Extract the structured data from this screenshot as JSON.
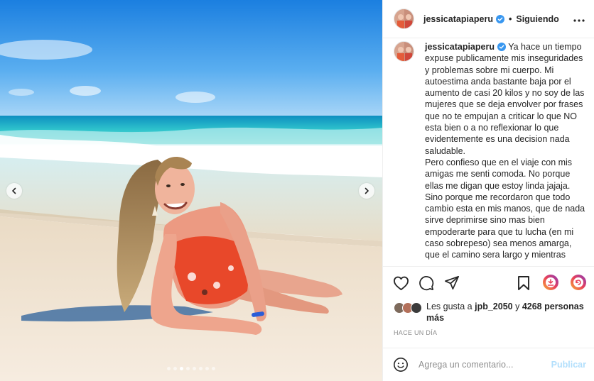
{
  "media": {
    "photo_alt": "",
    "carousel": {
      "total": 8,
      "active": 3
    },
    "icons": {
      "prev": "chevron-left-icon",
      "next": "chevron-right-icon"
    }
  },
  "header": {
    "username": "jessicatapiaperu",
    "separator": "•",
    "follow_status": "Siguiendo",
    "icons": {
      "verified": "verified-badge-icon",
      "more": "more-options-icon"
    }
  },
  "caption": {
    "username": "jessicatapiaperu",
    "text": "Ya hace un tiempo expuse publicamente mis inseguridades y problemas sobre mi cuerpo. Mi autoestima anda bastante baja por el aumento de casi 20 kilos y no soy de las mujeres que se deja envolver por frases que no te empujan a criticar lo que NO esta bien o a no reflexionar lo que evidentemente es una decision nada saludable.\nPero confieso que en el viaje con mis amigas me senti comoda. No porque ellas me digan que estoy linda jajaja. Sino porque me recordaron que todo cambio esta en mis manos, que de nada sirve deprimirse sino mas bien empoderarte para que tu lucha (en mi caso sobrepeso) sea menos amarga, que el camino sera largo y mientras"
  },
  "actions": {
    "icons": [
      "heart-icon",
      "comment-icon",
      "share-icon",
      "bookmark-icon",
      "extension-icon",
      "extension-icon"
    ]
  },
  "likes": {
    "prefix": "Les gusta a ",
    "user": "jpb_2050",
    "middle": " y ",
    "count": "4268 personas más"
  },
  "timestamp": "HACE UN DÍA",
  "comment_box": {
    "placeholder": "Agrega un comentario...",
    "publish_label": "Publicar",
    "emoji_icon": "emoji-icon"
  },
  "colors": {
    "accent_blue": "#0095f6",
    "publish_disabled": "#b2dffc",
    "muted_text": "#8e8e8e",
    "border": "#efefef"
  }
}
